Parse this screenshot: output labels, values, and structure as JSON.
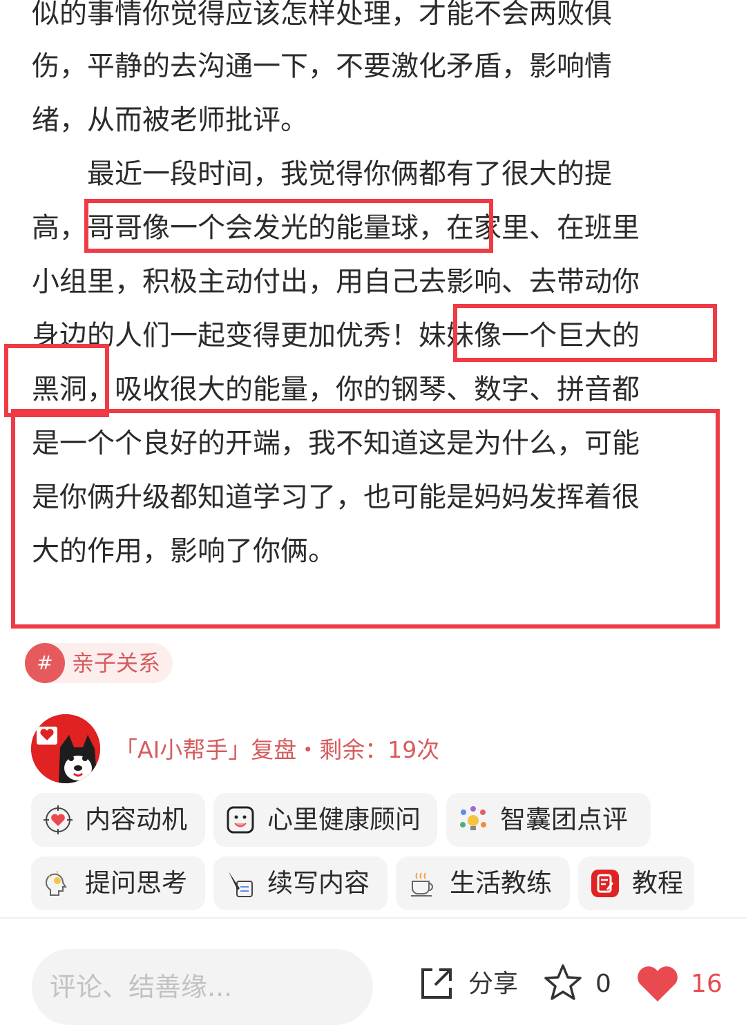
{
  "article": {
    "lines": [
      "似的事情你觉得应该怎样处理，才能不会两败俱",
      "伤，平静的去沟通一下，不要激化矛盾，影响情",
      "绪，从而被老师批评。",
      "最近一段时间，我觉得你俩都有了很大的提",
      "高，哥哥像一个会发光的能量球，在家里、在班里",
      "小组里，积极主动付出，用自己去影响、去带动你",
      "身边的人们一起变得更加优秀！妹妹像一个巨大的",
      "黑洞，吸收很大的能量，你的钢琴、数字、拼音都",
      "是一个个良好的开端，我不知道这是为什么，可能",
      "是你俩升级都知道学习了，也可能是妈妈发挥着很",
      "大的作用，影响了你俩。"
    ],
    "highlight_color": "#ef3b46"
  },
  "tag": {
    "symbol": "#",
    "label": "亲子关系"
  },
  "ai_helper": {
    "title": "「AI小帮手」复盘・剩余：19次"
  },
  "tools": [
    {
      "label": "内容动机",
      "icon": "target-heart-icon"
    },
    {
      "label": "心里健康顾问",
      "icon": "smiley-face-icon"
    },
    {
      "label": "智囊团点评",
      "icon": "idea-team-icon"
    },
    {
      "label": "提问思考",
      "icon": "thinking-head-icon"
    },
    {
      "label": "续写内容",
      "icon": "pen-paper-icon"
    },
    {
      "label": "生活教练",
      "icon": "coffee-cup-icon"
    },
    {
      "label": "教程",
      "icon": "tutorial-icon"
    }
  ],
  "bottom_bar": {
    "comment_placeholder": "评论、结善缘...",
    "share_label": "分享",
    "star_count": "0",
    "like_count": "16"
  },
  "colors": {
    "accent": "#e84a4f",
    "tag_text": "#d65c5c"
  }
}
